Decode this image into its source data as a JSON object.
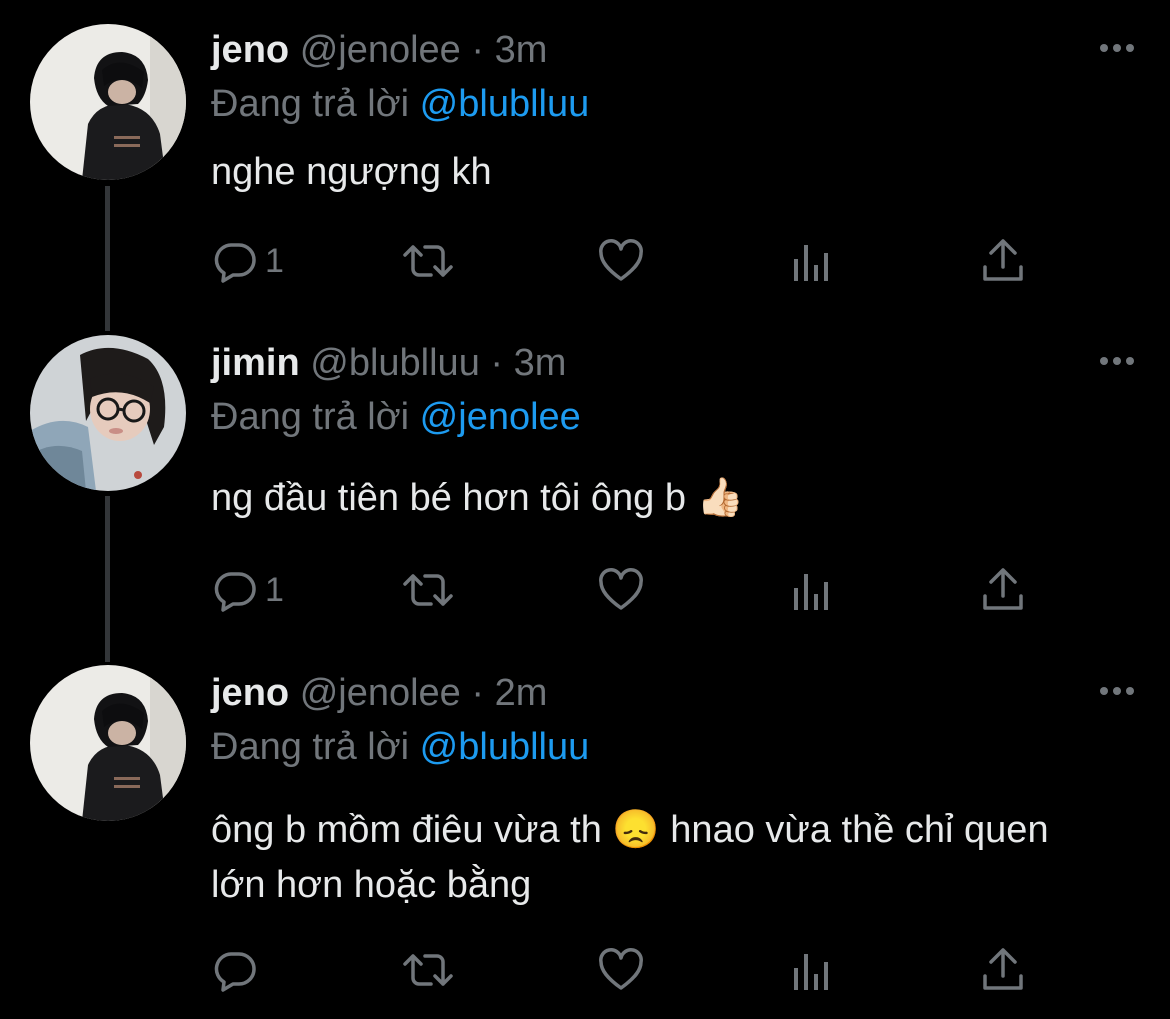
{
  "tweets": [
    {
      "name": "jeno",
      "handle": "@jenolee",
      "separator": "·",
      "time": "3m",
      "reply_prefix": "Đang trả lời",
      "reply_to": "@blublluu",
      "text": "nghe ngượng kh",
      "reply_count": "1",
      "avatar": "jeno-avatar"
    },
    {
      "name": "jimin",
      "handle": "@blublluu",
      "separator": "·",
      "time": "3m",
      "reply_prefix": "Đang trả lời",
      "reply_to": "@jenolee",
      "text": "ng đầu tiên bé hơn tôi ông b 👍🏻",
      "reply_count": "1",
      "avatar": "jimin-avatar"
    },
    {
      "name": "jeno",
      "handle": "@jenolee",
      "separator": "·",
      "time": "2m",
      "reply_prefix": "Đang trả lời",
      "reply_to": "@blublluu",
      "text": "ông b mồm điêu vừa th 😞  hnao vừa thề chỉ quen lớn hơn hoặc bằng",
      "reply_count": "",
      "avatar": "jeno-avatar"
    }
  ],
  "icons": {
    "reply": "reply-icon",
    "retweet": "retweet-icon",
    "like": "heart-icon",
    "views": "analytics-icon",
    "share": "share-icon",
    "more": "more-icon"
  },
  "colors": {
    "background": "#000000",
    "text": "#e7e9ea",
    "muted": "#71767b",
    "link": "#1d9bf0",
    "thread_line": "#333639"
  }
}
